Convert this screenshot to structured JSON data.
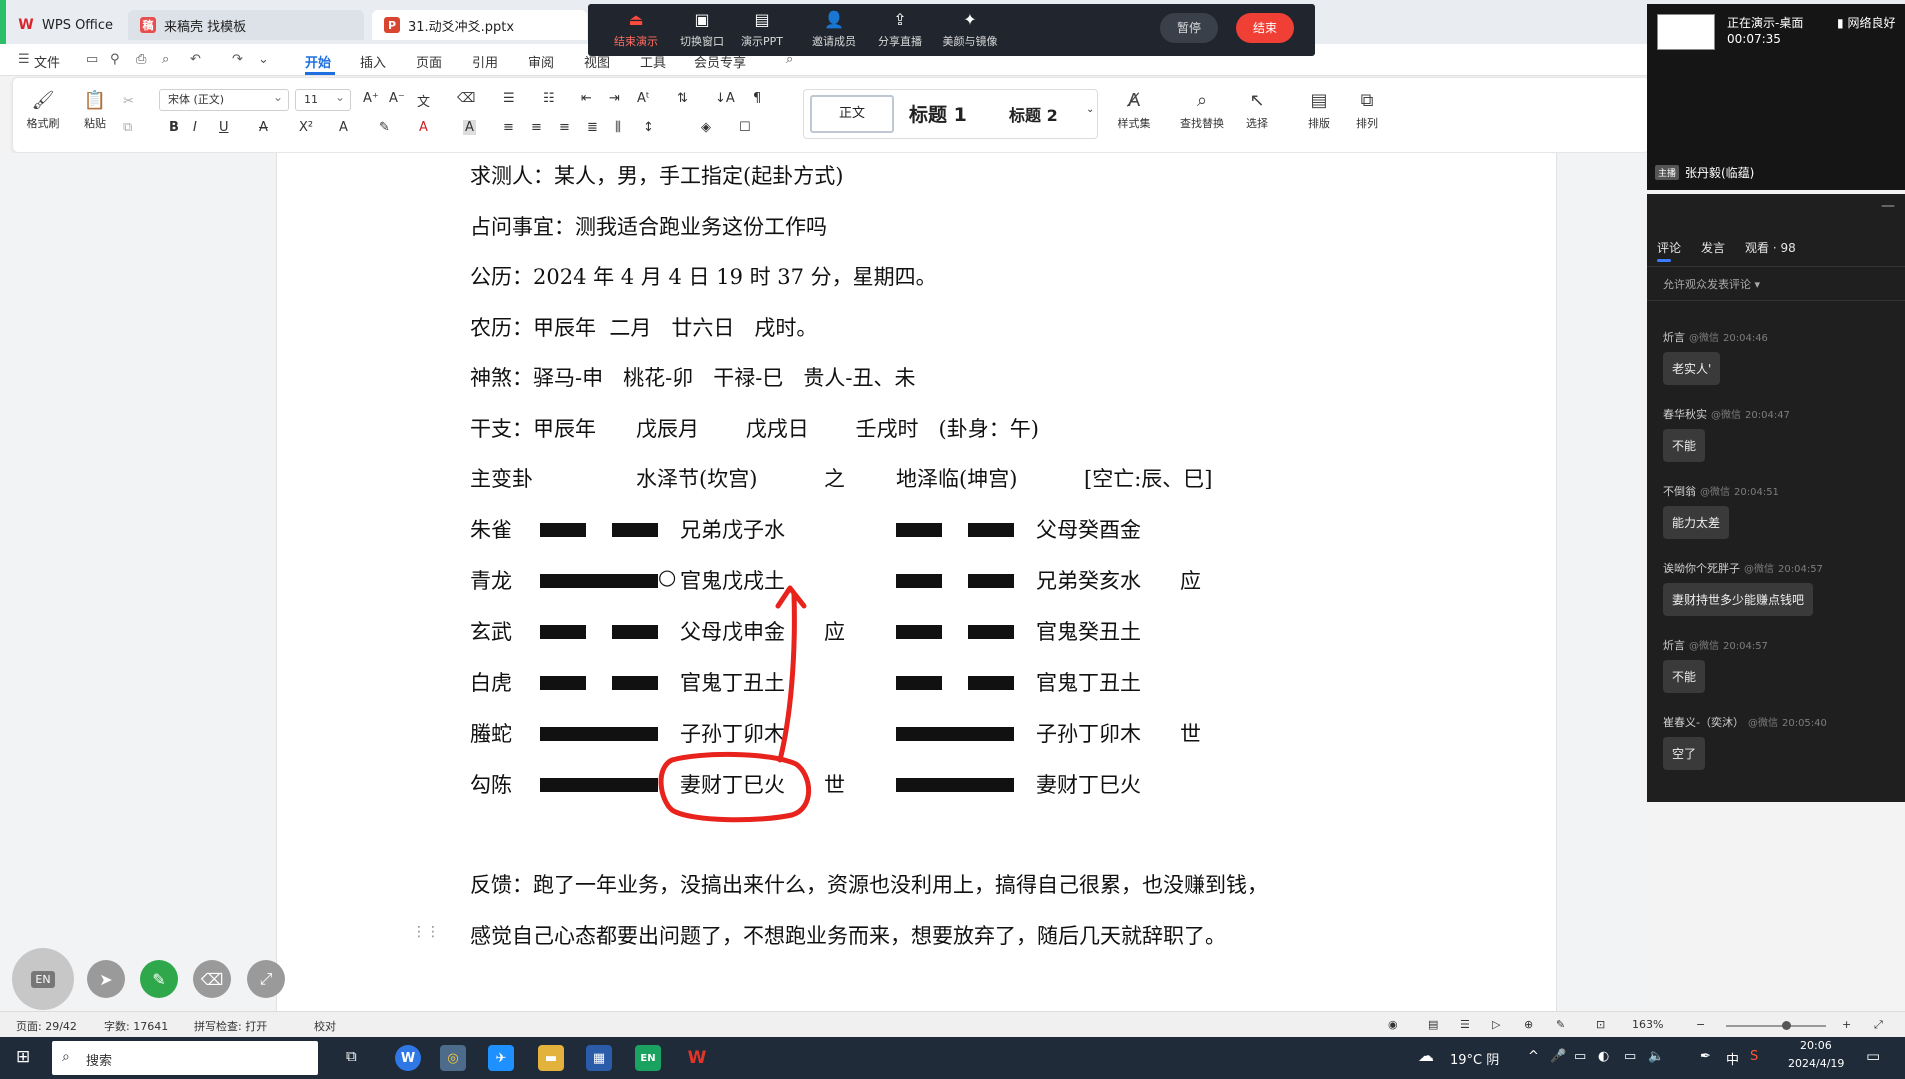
{
  "tabs": {
    "wps": "WPS Office",
    "template": "来稿壳 找模板",
    "ppt": "31.动爻冲爻.pptx"
  },
  "present_bar": {
    "end_demo": "结束演示",
    "switch_window": "切换窗口",
    "demo_ppt": "演示PPT",
    "invite": "邀请成员",
    "share_live": "分享直播",
    "beauty": "美颜与镜像",
    "pause": "暂停",
    "finish": "结束"
  },
  "menu": {
    "file": "文件",
    "items": [
      "开始",
      "插入",
      "页面",
      "引用",
      "审阅",
      "视图",
      "工具",
      "会员专享"
    ]
  },
  "ribbon": {
    "format_painter": "格式刷",
    "paste": "粘贴",
    "font_name": "宋体 (正文)",
    "font_size": "11",
    "style_normal": "正文",
    "style_h1": "标题 1",
    "style_h2": "标题 2",
    "style_set": "样式集",
    "find_replace": "查找替换",
    "select": "选择",
    "layout": "排版",
    "arrange": "排列"
  },
  "document": {
    "lines": [
      "求测人：某人，男，手工指定(起卦方式)",
      "占问事宜：测我适合跑业务这份工作吗",
      "公历：2024 年 4 月 4 日 19 时 37 分，星期四。",
      "农历：甲辰年  二月   廿六日   戌时。",
      "神煞：驿马-申   桃花-卯   干禄-巳   贵人-丑、未",
      "干支：甲辰年      戊辰月       戊戌日       壬戌时   (卦身：午)"
    ],
    "gua_header": {
      "label": "主变卦",
      "main": "水泽节(坎宫)",
      "zhi": "之",
      "changed": "地泽临(坤宫)",
      "kong": "[空亡:辰、巳]"
    },
    "yao": [
      {
        "god": "朱雀",
        "main_line": "yin",
        "moving": "",
        "main_text": "兄弟戊子水",
        "main_mark": "",
        "changed_line": "yin",
        "changed_text": "父母癸酉金",
        "changed_mark": ""
      },
      {
        "god": "青龙",
        "main_line": "yang",
        "moving": "○",
        "main_text": "官鬼戊戌土",
        "main_mark": "",
        "changed_line": "yin",
        "changed_text": "兄弟癸亥水",
        "changed_mark": "应"
      },
      {
        "god": "玄武",
        "main_line": "yin",
        "moving": "",
        "main_text": "父母戊申金",
        "main_mark": "应",
        "changed_line": "yin",
        "changed_text": "官鬼癸丑土",
        "changed_mark": ""
      },
      {
        "god": "白虎",
        "main_line": "yin",
        "moving": "",
        "main_text": "官鬼丁丑土",
        "main_mark": "",
        "changed_line": "yin",
        "changed_text": "官鬼丁丑土",
        "changed_mark": ""
      },
      {
        "god": "螣蛇",
        "main_line": "yang",
        "moving": "",
        "main_text": "子孙丁卯木",
        "main_mark": "",
        "changed_line": "yang",
        "changed_text": "子孙丁卯木",
        "changed_mark": "世"
      },
      {
        "god": "勾陈",
        "main_line": "yang",
        "moving": "",
        "main_text": "妻财丁巳火",
        "main_mark": "世",
        "changed_line": "yang",
        "changed_text": "妻财丁巳火",
        "changed_mark": ""
      }
    ],
    "feedback_1": "反馈：跑了一年业务，没搞出来什么，资源也没利用上，搞得自己很累，也没赚到钱，",
    "feedback_2": "感觉自己心态都要出问题了，不想跑业务而来，想要放弃了，随后几天就辞职了。",
    "annotation_color": "#e8221c"
  },
  "floating_tools": {
    "lang": "EN"
  },
  "status": {
    "page": "页面: 29/42",
    "words": "字数: 17641",
    "spell": "拼写检查: 打开",
    "proof": "校对",
    "zoom": "163%"
  },
  "taskbar": {
    "search": "搜索",
    "weather": "19°C 阴",
    "ime": "中",
    "time": "20:06",
    "date": "2024/4/19",
    "en_app": "EN"
  },
  "live": {
    "status": "正在演示-桌面",
    "elapsed": "00:07:35",
    "network": "网络良好",
    "host_badge": "主播",
    "host_name": "张丹毅(临蕴)",
    "tabs": [
      "评论",
      "发言",
      "观看 · 98"
    ],
    "allow_comments": "允许观众发表评论",
    "comments": [
      {
        "user": "炘言",
        "via": "@微信",
        "time": "20:04:46",
        "text": "老实人'"
      },
      {
        "user": "春华秋实",
        "via": "@微信",
        "time": "20:04:47",
        "text": "不能"
      },
      {
        "user": "不倒翁",
        "via": "@微信",
        "time": "20:04:51",
        "text": "能力太差"
      },
      {
        "user": "诶呦你个死胖子",
        "via": "@微信",
        "time": "20:04:57",
        "text": "妻财持世多少能赚点钱吧"
      },
      {
        "user": "炘言",
        "via": "@微信",
        "time": "20:04:57",
        "text": "不能"
      },
      {
        "user": "崔春义-（奕沐）",
        "via": "@微信",
        "time": "20:05:40",
        "text": "空了"
      }
    ]
  }
}
